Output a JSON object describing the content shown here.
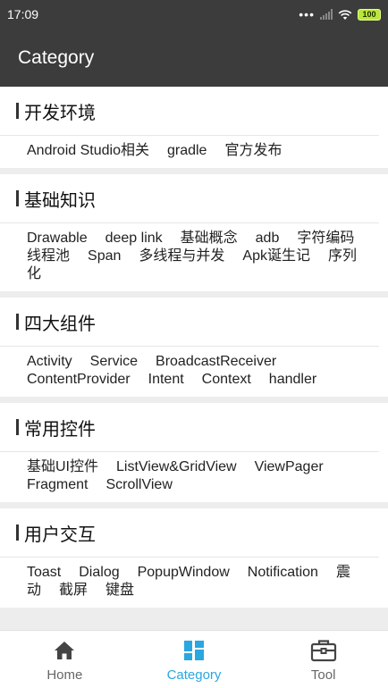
{
  "status": {
    "time": "17:09",
    "dots": "•••",
    "battery": "100"
  },
  "appbar": {
    "title": "Category"
  },
  "sections": [
    {
      "title": "开发环境",
      "tags": [
        "Android Studio相关",
        "gradle",
        "官方发布"
      ]
    },
    {
      "title": "基础知识",
      "tags": [
        "Drawable",
        "deep link",
        "基础概念",
        "adb",
        "字符编码",
        "线程池",
        "Span",
        "多线程与并发",
        "Apk诞生记",
        "序列",
        "化"
      ]
    },
    {
      "title": "四大组件",
      "tags": [
        "Activity",
        "Service",
        "BroadcastReceiver",
        "ContentProvider",
        "Intent",
        "Context",
        "handler"
      ]
    },
    {
      "title": "常用控件",
      "tags": [
        "基础UI控件",
        "ListView&GridView",
        "ViewPager",
        "Fragment",
        "ScrollView"
      ]
    },
    {
      "title": "用户交互",
      "tags": [
        "Toast",
        "Dialog",
        "PopupWindow",
        "Notification",
        "震",
        "动",
        "截屏",
        "键盘"
      ]
    }
  ],
  "nav": {
    "items": [
      {
        "label": "Home",
        "icon": "home-icon"
      },
      {
        "label": "Category",
        "icon": "category-icon"
      },
      {
        "label": "Tool",
        "icon": "toolbox-icon"
      }
    ],
    "active_index": 1,
    "active_color": "#29a7e0"
  },
  "colors": {
    "appbar": "#3c3c3c",
    "background": "#ededed",
    "battery": "#b9e63a"
  }
}
